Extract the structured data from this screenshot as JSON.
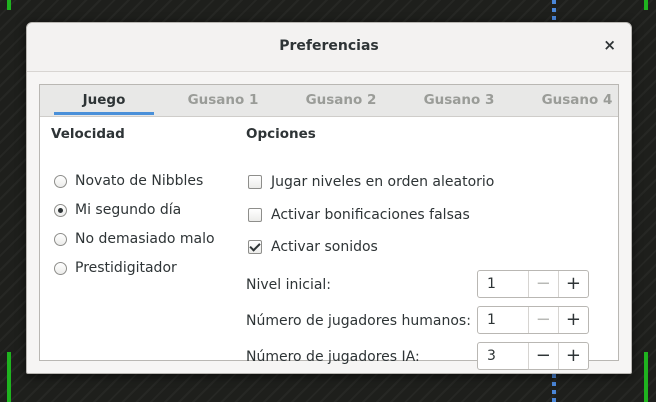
{
  "dialog": {
    "title": "Preferencias"
  },
  "tabs": [
    {
      "label": "Juego",
      "active": true
    },
    {
      "label": "Gusano 1",
      "active": false
    },
    {
      "label": "Gusano 2",
      "active": false
    },
    {
      "label": "Gusano 3",
      "active": false
    },
    {
      "label": "Gusano 4",
      "active": false
    }
  ],
  "speed": {
    "title": "Velocidad",
    "options": [
      {
        "label": "Novato de Nibbles",
        "selected": false
      },
      {
        "label": "Mi segundo día",
        "selected": true
      },
      {
        "label": "No demasiado malo",
        "selected": false
      },
      {
        "label": "Prestidigitador",
        "selected": false
      }
    ]
  },
  "options": {
    "title": "Opciones",
    "checks": [
      {
        "label": "Jugar niveles en orden aleatorio",
        "checked": false
      },
      {
        "label": "Activar bonificaciones falsas",
        "checked": false
      },
      {
        "label": "Activar sonidos",
        "checked": true
      }
    ]
  },
  "spinners": [
    {
      "label": "Nivel inicial:",
      "value": "1",
      "minus": "−",
      "plus": "+",
      "minus_enabled": false
    },
    {
      "label": "Número de jugadores humanos:",
      "value": "1",
      "minus": "−",
      "plus": "+",
      "minus_enabled": false
    },
    {
      "label": "Número de jugadores IA:",
      "value": "3",
      "minus": "−",
      "plus": "+",
      "minus_enabled": true
    }
  ],
  "icons": {
    "close": "×"
  },
  "colors": {
    "accent": "#4a90d9",
    "game_wall": "#1fb31f",
    "game_dots": "#4a86d8"
  }
}
